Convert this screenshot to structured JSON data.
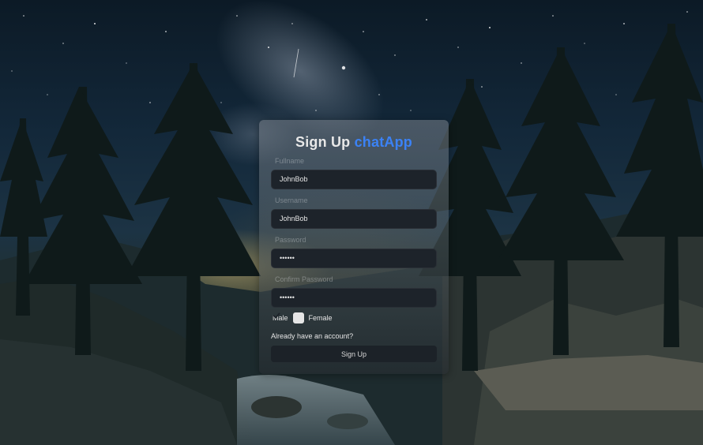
{
  "page": {
    "title_prefix": "Sign Up",
    "title_brand": "chatApp"
  },
  "form": {
    "fullname": {
      "label": "Fullname",
      "value": "JohnBob"
    },
    "username": {
      "label": "Username",
      "value": "JohnBob"
    },
    "password": {
      "label": "Password",
      "value": "••••••"
    },
    "confirm_password": {
      "label": "Confirm Password",
      "value": "••••••"
    },
    "gender": {
      "male_label": "Male",
      "female_label": "Female",
      "checked": true
    },
    "login_link": "Already have an account?",
    "submit_label": "Sign Up"
  },
  "colors": {
    "brand": "#3b82f6",
    "field_bg": "#1d232a",
    "button_bg": "#1c2228"
  }
}
